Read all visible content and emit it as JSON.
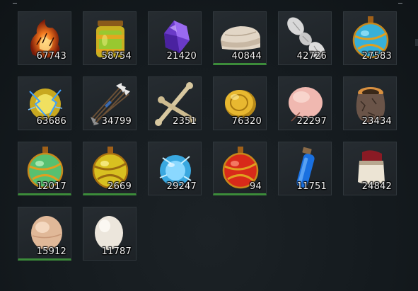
{
  "inventory": {
    "items": [
      {
        "name": "fire-essence",
        "count": "67743",
        "rarity": "common"
      },
      {
        "name": "honey-jar",
        "count": "58754",
        "rarity": "common"
      },
      {
        "name": "purple-crystal",
        "count": "21420",
        "rarity": "common"
      },
      {
        "name": "folded-cloth",
        "count": "40844",
        "rarity": "uncommon"
      },
      {
        "name": "silk-cocoons",
        "count": "42726",
        "rarity": "common"
      },
      {
        "name": "blue-orb-flask",
        "count": "27583",
        "rarity": "common"
      },
      {
        "name": "lightning-orb",
        "count": "63686",
        "rarity": "common"
      },
      {
        "name": "arrow-bundle",
        "count": "34799",
        "rarity": "common"
      },
      {
        "name": "bones",
        "count": "2351",
        "rarity": "common"
      },
      {
        "name": "gold-coin",
        "count": "76320",
        "rarity": "common"
      },
      {
        "name": "pink-cotton",
        "count": "22297",
        "rarity": "common"
      },
      {
        "name": "rock-pot",
        "count": "23434",
        "rarity": "common"
      },
      {
        "name": "green-orb-flask",
        "count": "12017",
        "rarity": "uncommon"
      },
      {
        "name": "yellow-orb-flask",
        "count": "2669",
        "rarity": "uncommon"
      },
      {
        "name": "frost-orb",
        "count": "29247",
        "rarity": "common"
      },
      {
        "name": "red-orb-flask",
        "count": "94",
        "rarity": "uncommon"
      },
      {
        "name": "blue-vial",
        "count": "11751",
        "rarity": "common"
      },
      {
        "name": "sealed-jar",
        "count": "24842",
        "rarity": "common"
      },
      {
        "name": "beige-egg",
        "count": "15912",
        "rarity": "uncommon"
      },
      {
        "name": "white-egg",
        "count": "11787",
        "rarity": "common"
      }
    ]
  },
  "colors": {
    "uncommon_border": "#3c8c3a",
    "slot_bg": "#22282d"
  }
}
